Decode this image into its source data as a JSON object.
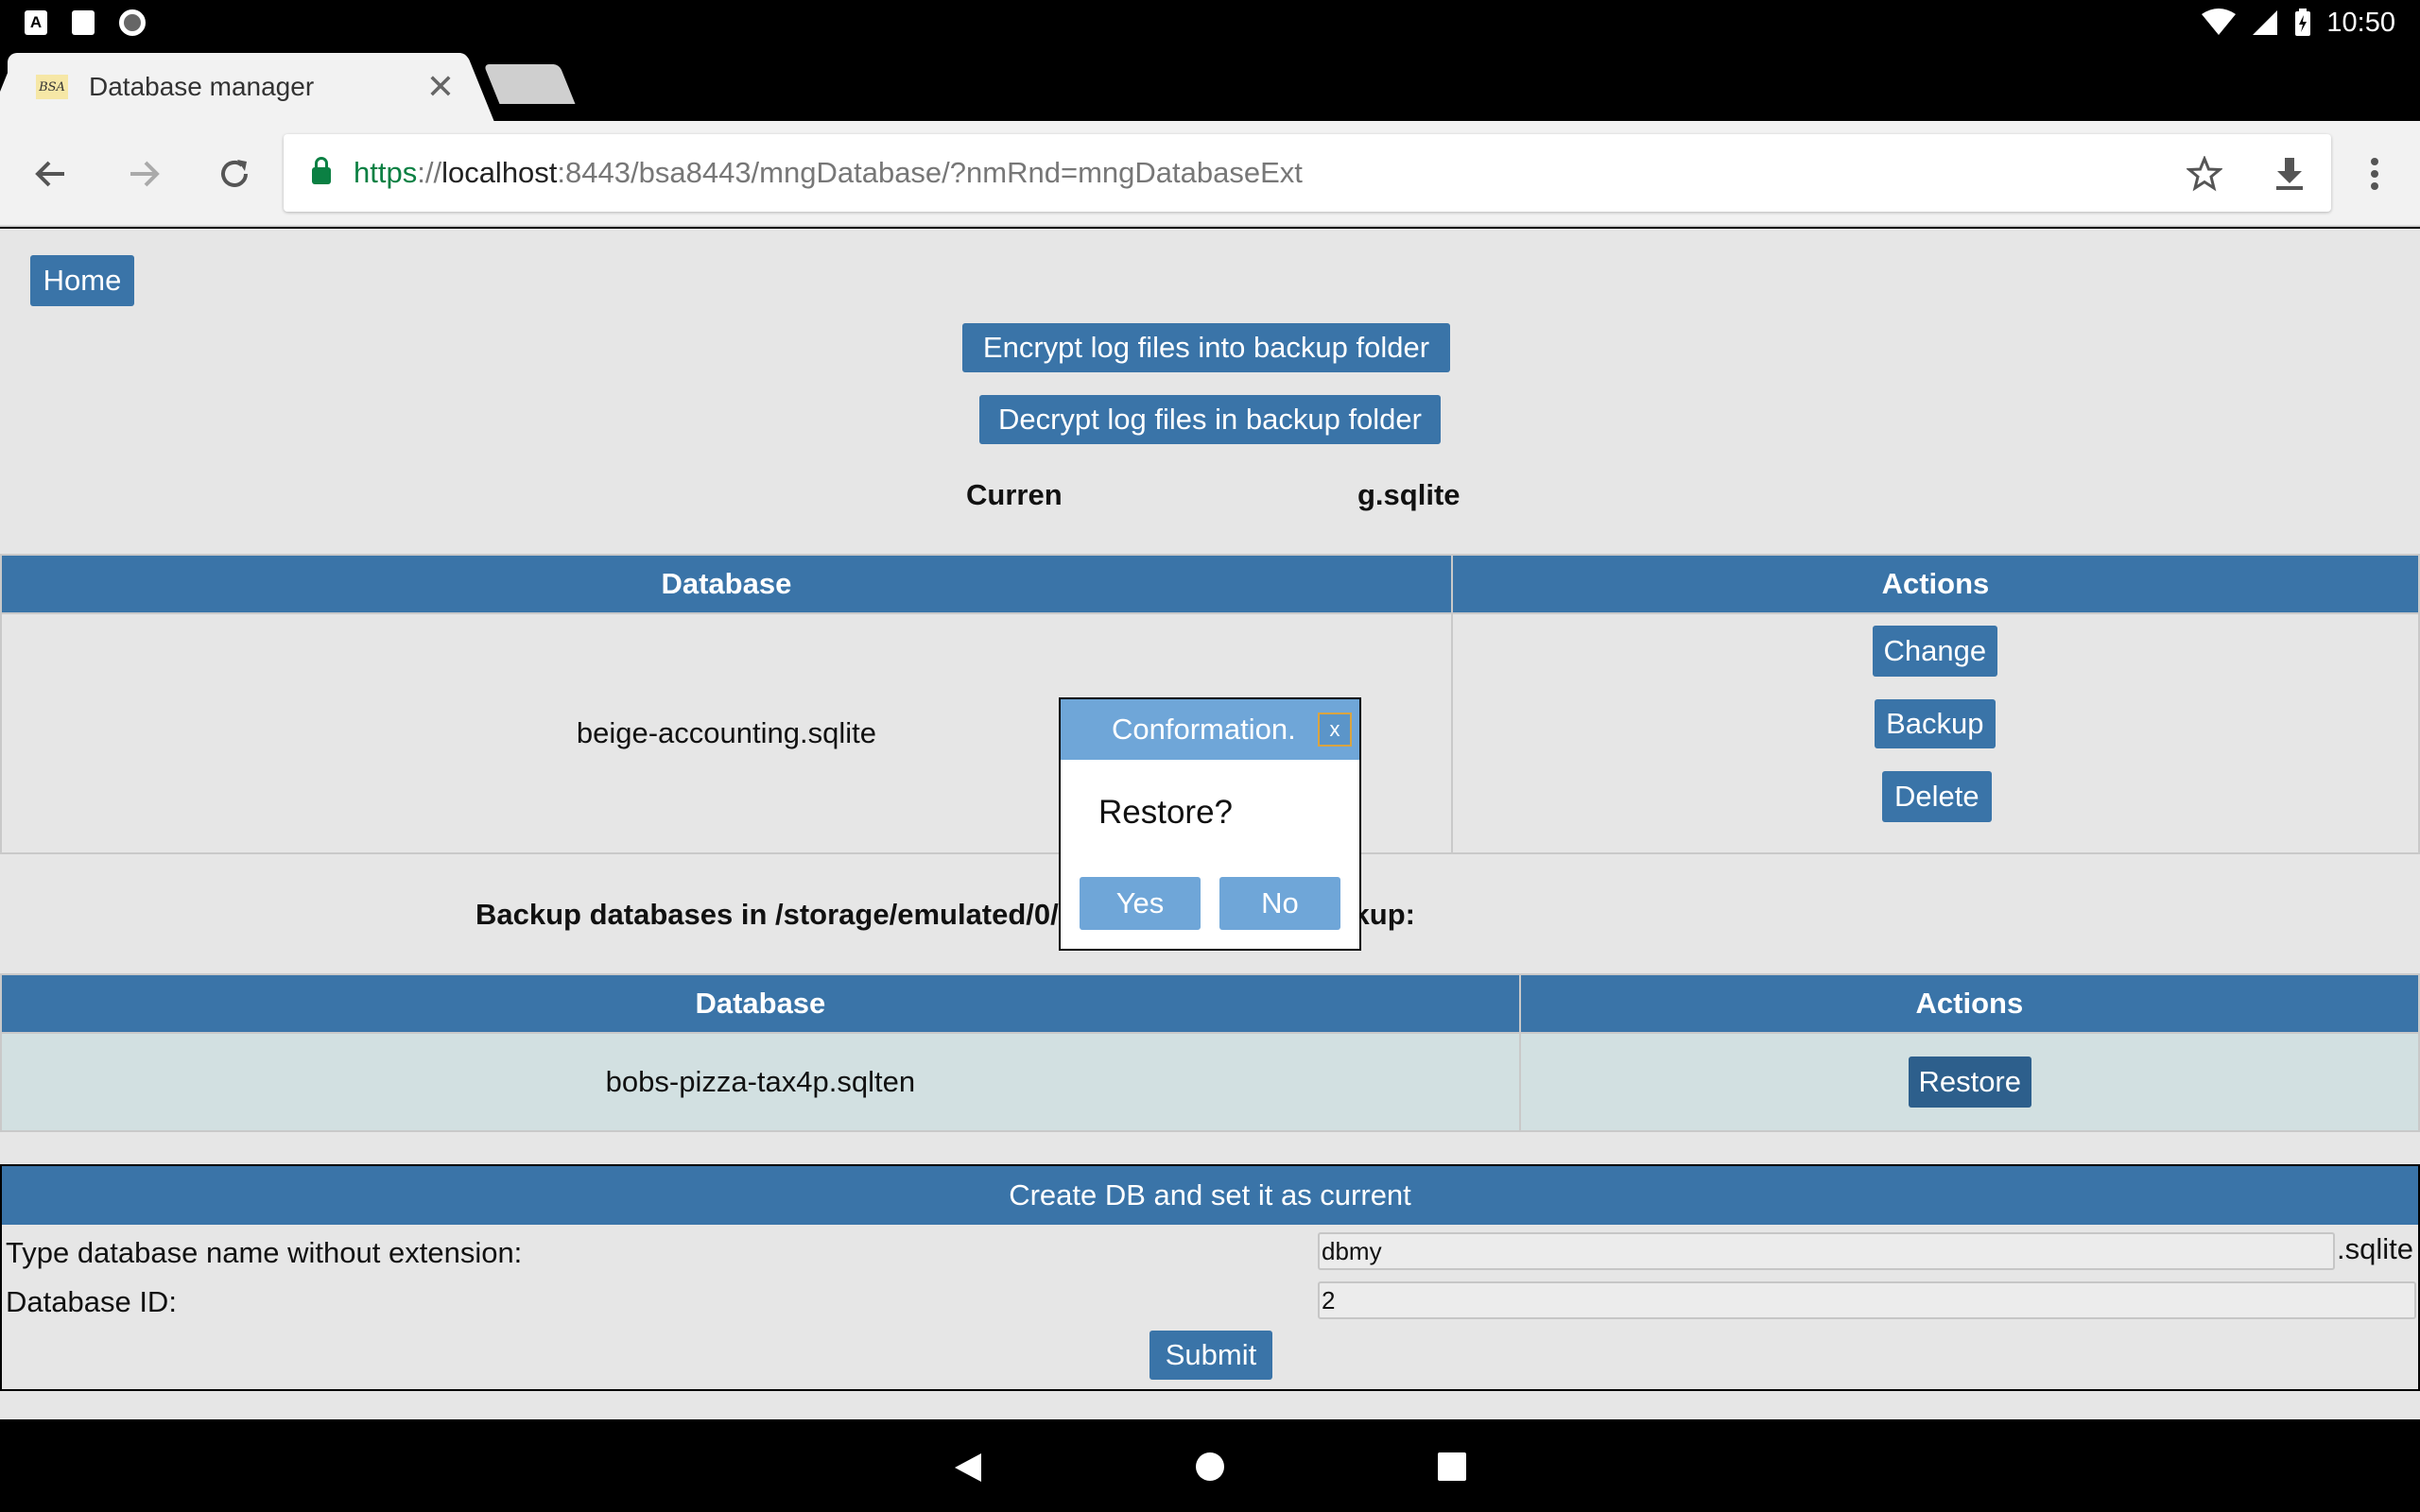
{
  "status_bar": {
    "time": "10:50"
  },
  "browser": {
    "tab_title": "Database manager",
    "favicon_text": "BSA",
    "url_scheme": "https",
    "url_sep": "://",
    "url_host": "localhost",
    "url_rest": ":8443/bsa8443/mngDatabase/?nmRnd=mngDatabaseExt"
  },
  "page": {
    "home_label": "Home",
    "encrypt_label": "Encrypt log files into backup folder",
    "decrypt_label": "Decrypt log files in backup folder",
    "current_prefix": "Curren",
    "current_suffix": "g.sqlite",
    "current_table": {
      "headers": [
        "Database",
        "Actions"
      ],
      "database": "beige-accounting.sqlite",
      "actions": [
        "Change",
        "Backup",
        "Delete"
      ]
    },
    "backup_heading": "Backup databases in /storage/emulated/0/BeigeAccountingBackup:",
    "backup_table": {
      "headers": [
        "Database",
        "Actions"
      ],
      "rows": [
        {
          "database": "bobs-pizza-tax4p.sqlten",
          "action": "Restore"
        }
      ]
    },
    "create_form": {
      "title": "Create DB and set it as current",
      "name_label": "Type database name without extension:",
      "name_value": "dbmy",
      "name_suffix": ".sqlite",
      "id_label": "Database ID:",
      "id_value": "2",
      "submit_label": "Submit"
    }
  },
  "modal": {
    "title": "Conformation.",
    "close_label": "x",
    "message": "Restore?",
    "yes_label": "Yes",
    "no_label": "No"
  },
  "colors": {
    "primary": "#3a74a8",
    "modal_header": "#6fa6d8",
    "secure_green": "#0b8043",
    "page_bg": "#e6e6e6"
  }
}
